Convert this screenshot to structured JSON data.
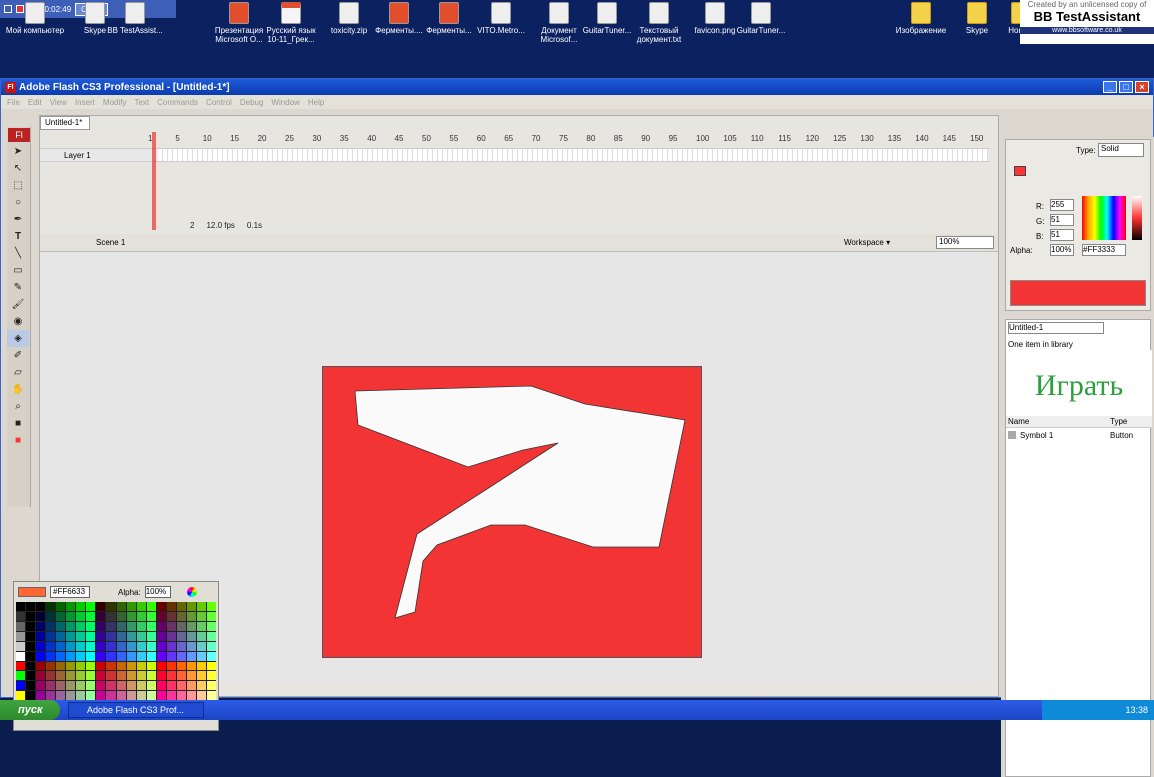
{
  "desktop": {
    "icons": [
      {
        "label": "Мой компьютер",
        "kind": "pc"
      },
      {
        "label": "Skype",
        "kind": "skype"
      },
      {
        "label": "BB TestAssist...",
        "kind": "bb"
      },
      {
        "label": "Презентация Microsoft O...",
        "kind": "ppt"
      },
      {
        "label": "Русский язык 10-11_Грек...",
        "kind": "pdf"
      },
      {
        "label": "toxicity.zip",
        "kind": "zip"
      },
      {
        "label": "Ферменты....",
        "kind": "ppt"
      },
      {
        "label": "Ферменты...",
        "kind": "ppt"
      },
      {
        "label": "VITO.Metro...",
        "kind": "doc"
      },
      {
        "label": "Документ Microsof...",
        "kind": "doc"
      },
      {
        "label": "GuitarTuner...",
        "kind": "app"
      },
      {
        "label": "Текстовый документ.txt",
        "kind": "txt"
      },
      {
        "label": "favicon.png",
        "kind": "png"
      },
      {
        "label": "GuitarTuner...",
        "kind": "app"
      },
      {
        "label": "Изображение",
        "kind": "folder"
      },
      {
        "label": "Skype",
        "kind": "folder"
      },
      {
        "label": "Нова...",
        "kind": "folder"
      }
    ]
  },
  "recorder": {
    "timer": "00:02:49",
    "close_label": "Close"
  },
  "watermark": {
    "line1": "Created by an unlicensed copy of",
    "line2": "BB TestAssistant",
    "line3": "www.bbsoftware.co.uk"
  },
  "app": {
    "title": "Adobe Flash CS3 Professional - [Untitled-1*]",
    "menu": [
      "File",
      "Edit",
      "View",
      "Insert",
      "Modify",
      "Text",
      "Commands",
      "Control",
      "Debug",
      "Window",
      "Help"
    ]
  },
  "timeline": {
    "doc_tab": "Untitled-1*",
    "frame_numbers": [
      "1",
      "5",
      "10",
      "15",
      "20",
      "25",
      "30",
      "35",
      "40",
      "45",
      "50",
      "55",
      "60",
      "65",
      "70",
      "75",
      "80",
      "85",
      "90",
      "95",
      "100",
      "105",
      "110",
      "115",
      "120",
      "125",
      "130",
      "135",
      "140",
      "145",
      "150"
    ],
    "layer_name": "Layer 1",
    "current_frame": "2",
    "fps": "12.0 fps",
    "time": "0.1s"
  },
  "editbar": {
    "scene": "Scene 1",
    "workspace": "Workspace ▾",
    "zoom": "100%"
  },
  "swatches": {
    "hex": "#FF6633",
    "alpha_label": "Alpha:",
    "alpha": "100%"
  },
  "color_panel": {
    "type_label": "Type:",
    "type_value": "Solid",
    "r_label": "R:",
    "r": "255",
    "g_label": "G:",
    "g": "51",
    "b_label": "B:",
    "b": "51",
    "alpha_label": "Alpha:",
    "alpha": "100%",
    "hex": "#FF3333"
  },
  "library": {
    "doc": "Untitled-1",
    "count": "One item in library",
    "preview_text": "Играть",
    "col_name": "Name",
    "col_type": "Type",
    "items": [
      {
        "name": "Symbol 1",
        "type": "Button"
      }
    ]
  },
  "taskbar": {
    "start": "пуск",
    "item": "Adobe Flash CS3 Prof...",
    "clock": "13:38"
  },
  "colors": {
    "stage_fill": "#f23434",
    "shape_fill": "#fafafa",
    "fill_color": "#ff3333",
    "swatch_selected": "#ff6633"
  }
}
